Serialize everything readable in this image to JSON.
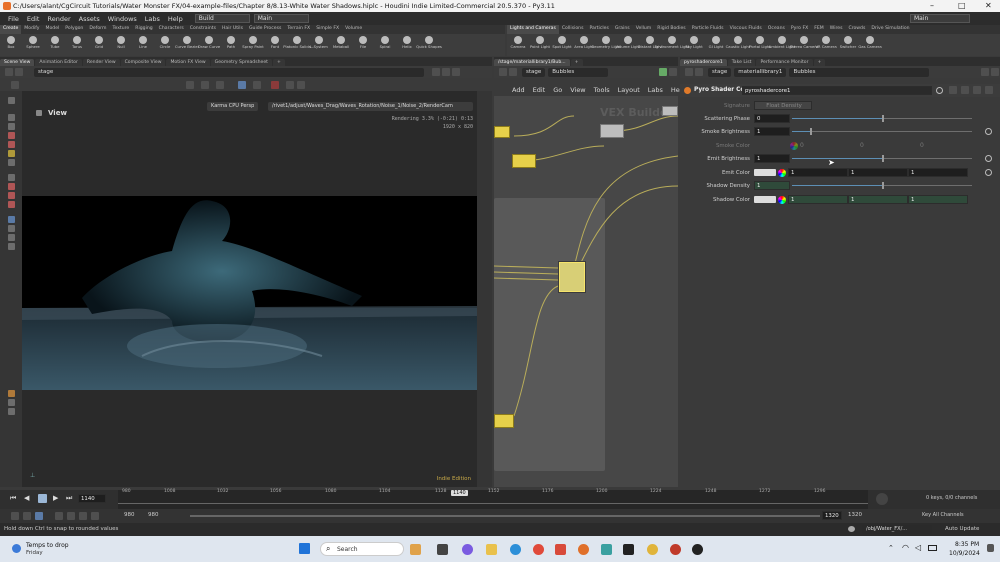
{
  "window": {
    "title": "C:/Users/alant/CgCircuit Tutorials/Water Monster FX/04-example-files/Chapter 8/8.13-White Water Shadows.hiplc - Houdini Indie Limited-Commercial 20.5.370 - Py3.11",
    "min": "–",
    "max": "□",
    "close": "✕"
  },
  "menu": {
    "items": [
      "File",
      "Edit",
      "Render",
      "Assets",
      "Windows",
      "Labs",
      "Help"
    ],
    "desktop": "Build",
    "session": "Main",
    "right_desktop": "Main"
  },
  "shelf_tabs_left": [
    "Create",
    "Modify",
    "Model",
    "Polygon",
    "Deform",
    "Texture",
    "Rigging",
    "Characters",
    "Constraints",
    "Hair Utils",
    "Guide Process",
    "Terrain FX",
    "Simple FX",
    "Volume"
  ],
  "shelf_tabs_right": [
    "Lights and Cameras",
    "Collisions",
    "Particles",
    "Grains",
    "Vellum",
    "Rigid Bodies",
    "Particle Fluids",
    "Viscous Fluids",
    "Oceans",
    "Pyro FX",
    "FEM",
    "Wires",
    "Crowds",
    "Drive Simulation"
  ],
  "shelf_tools_left": [
    "Box",
    "Sphere",
    "Tube",
    "Torus",
    "Grid",
    "Null",
    "Line",
    "Circle",
    "Curve Bezier",
    "Draw Curve",
    "Path",
    "Spray Paint",
    "Font",
    "Platonic Solids",
    "L-System",
    "Metaball",
    "File",
    "Spiral",
    "Helix",
    "Quick Shapes"
  ],
  "shelf_tools_right": [
    "Camera",
    "Point Light",
    "Spot Light",
    "Area Light",
    "Geometry Light",
    "Volume Light",
    "Distant Light",
    "Environment Light",
    "Sky Light",
    "GI Light",
    "Caustic Light",
    "Portal Light",
    "Ambient Light",
    "Stereo Camera",
    "VR Camera",
    "Switcher",
    "Gas Camera"
  ],
  "left_pane": {
    "tabs": [
      "Scene View",
      "Animation Editor",
      "Render View",
      "Composite View",
      "Motion FX View",
      "Geometry Spreadsheet"
    ],
    "path": "stage",
    "view_label": "View",
    "renderer": "Karma CPU Persp",
    "camera_path": "/rivet1/adjust/Waves_Drag/Waves_Rotation/Noise_1/Noise_2/RenderCam",
    "render_status": "Rendering  3.3%  (-0:21)  0:13",
    "resolution": "1920 x 820",
    "edition": "Indie Edition"
  },
  "mid_pane": {
    "tabs": [
      "/stage/materiallibrary1/Bub..."
    ],
    "path_root": "stage",
    "path_child": "Bubbles",
    "menu": [
      "Add",
      "Edit",
      "Go",
      "View",
      "Tools",
      "Layout",
      "Labs",
      "Help"
    ],
    "watermark": "VEX Builder"
  },
  "right_pane": {
    "tabs": [
      "pyroshadercore1",
      "Take List",
      "Performance Monitor"
    ],
    "path": [
      "stage",
      "materiallibrary1",
      "Bubbles"
    ],
    "node_type": "Pyro Shader Core",
    "node_name": "pyroshadercore1",
    "params": [
      {
        "label": "Signature",
        "value": "Float Density",
        "disabled": true,
        "kind": "menu"
      },
      {
        "label": "Scattering Phase",
        "value": "0",
        "kind": "slider",
        "level": 0.5
      },
      {
        "label": "Smoke Brightness",
        "value": "1",
        "kind": "slider",
        "level": 0.1
      },
      {
        "label": "Smoke Color",
        "values": [
          "0",
          "0",
          "0"
        ],
        "disabled": true,
        "kind": "color"
      },
      {
        "label": "Emit Brightness",
        "value": "1",
        "kind": "slider",
        "level": 0.5
      },
      {
        "label": "Emit Color",
        "values": [
          "1",
          "1",
          "1"
        ],
        "kind": "color"
      },
      {
        "label": "Shadow Density",
        "value": "1",
        "kind": "slider",
        "level": 0.5
      },
      {
        "label": "Shadow Color",
        "values": [
          "1",
          "1",
          "1"
        ],
        "kind": "color"
      }
    ]
  },
  "timeline": {
    "current_frame": "1140",
    "playhead_frame": "1140",
    "ticks": [
      "980",
      "1008",
      "1032",
      "1056",
      "1080",
      "1104",
      "1128",
      "1152",
      "1176",
      "1200",
      "1224",
      "1248",
      "1272",
      "1296"
    ],
    "range_start": "980",
    "range_start2": "980",
    "range_end": "1320",
    "range_end2": "1320",
    "keys": "0 keys, 0/0 channels",
    "key_all": "Key All Channels",
    "obj_path": "/obj/Water_FX/...",
    "auto_update": "Auto Update"
  },
  "status": {
    "message": "Hold down Ctrl to snap to rounded values"
  },
  "taskbar": {
    "weather": "Temps to drop",
    "weather_sub": "Friday",
    "search": "Search",
    "time": "8:35 PM",
    "date": "10/9/2024"
  }
}
